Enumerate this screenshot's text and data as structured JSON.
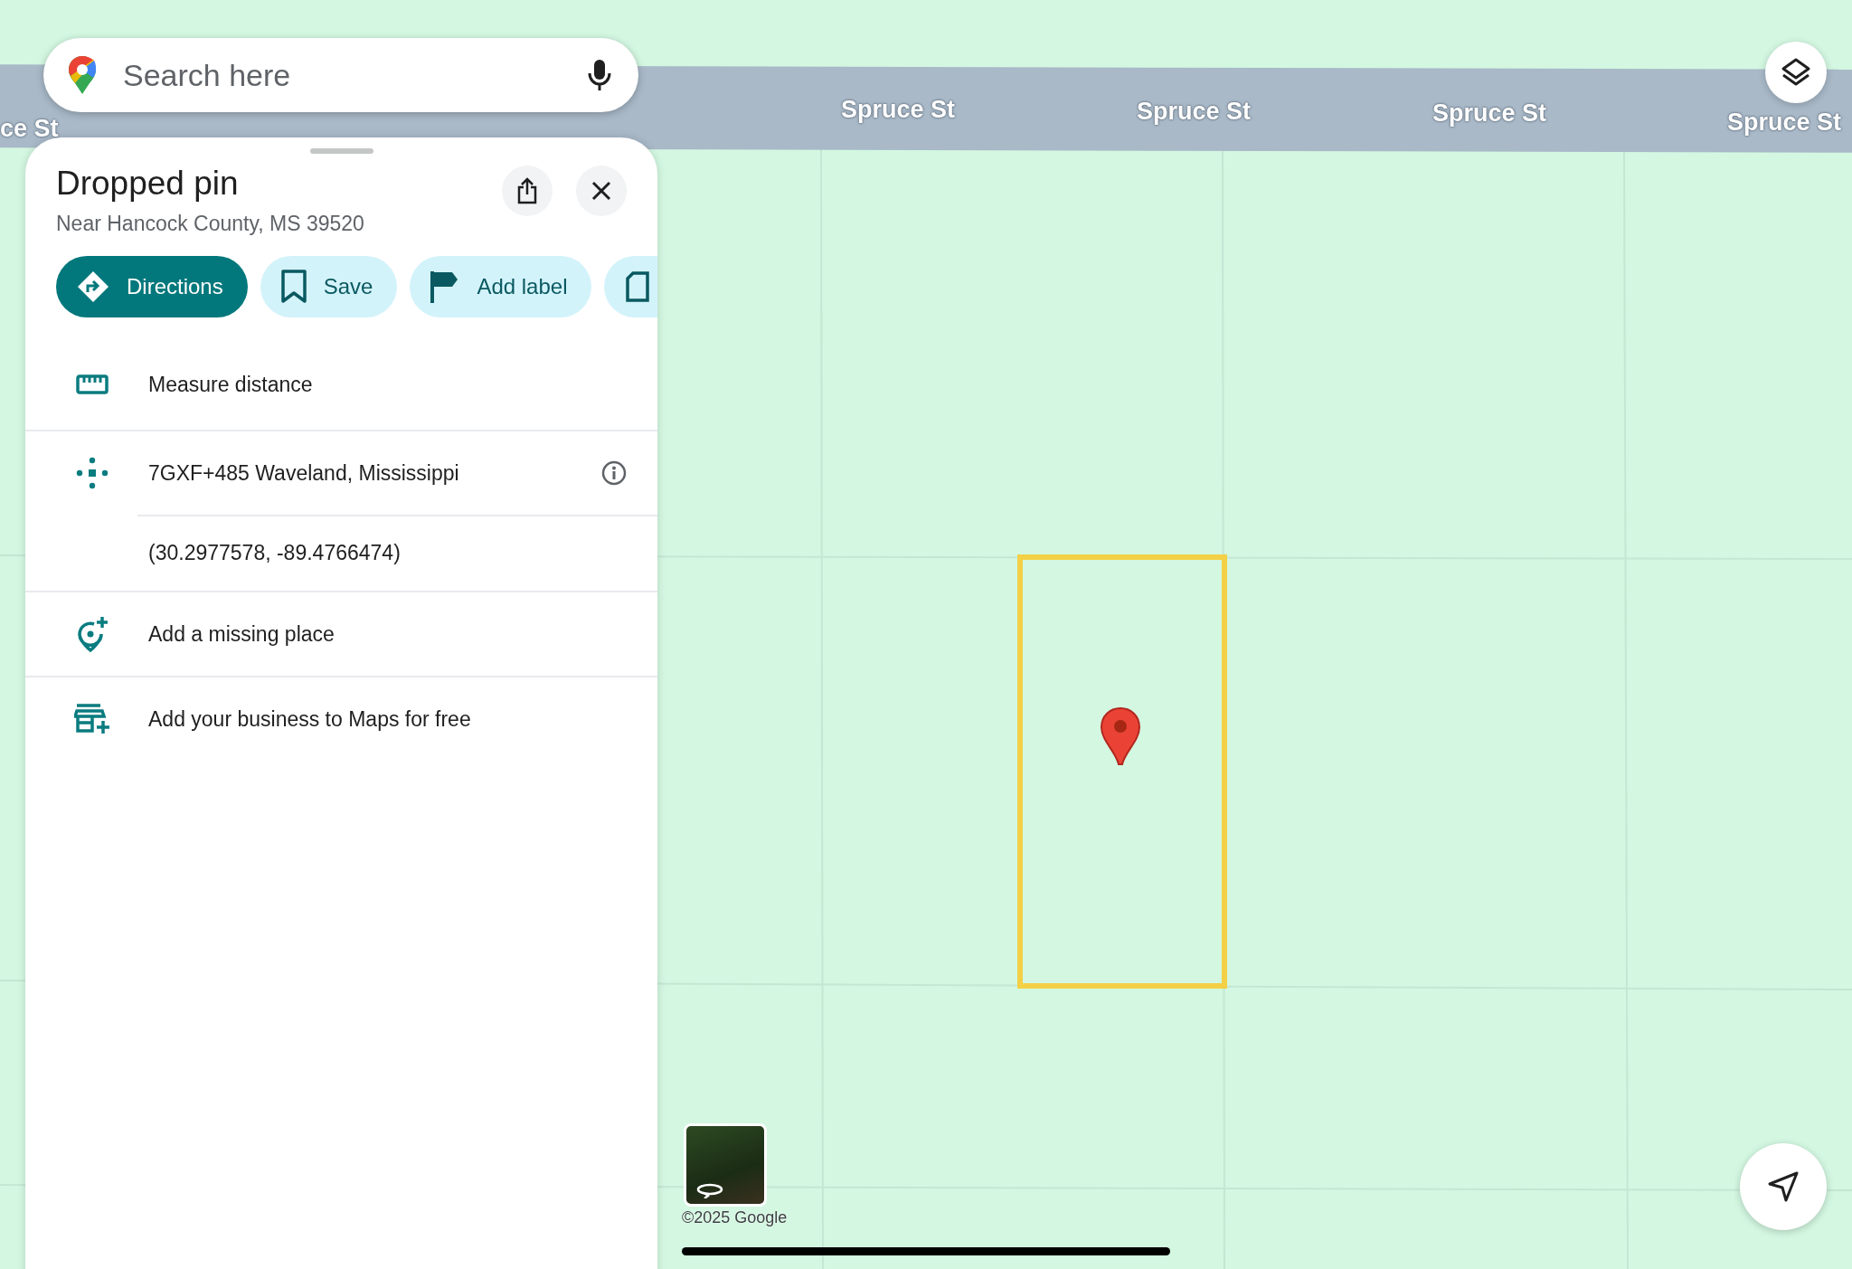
{
  "search": {
    "placeholder": "Search here"
  },
  "map": {
    "street_labels": [
      "ce St",
      "Spruce St",
      "Spruce St",
      "Spruce St",
      "Spruce St"
    ],
    "copyright": "©2025 Google"
  },
  "place": {
    "title": "Dropped pin",
    "subtitle": "Near Hancock County, MS 39520"
  },
  "actions": [
    {
      "kind": "directions",
      "label": "Directions",
      "primary": true
    },
    {
      "kind": "save",
      "label": "Save",
      "primary": false
    },
    {
      "kind": "flag",
      "label": "Add label",
      "primary": false
    },
    {
      "kind": "more",
      "primary": false
    }
  ],
  "details": [
    {
      "kind": "measure",
      "text": "Measure distance",
      "info": false
    },
    {
      "kind": "pluscode",
      "text": "7GXF+485 Waveland, Mississippi",
      "info": true
    },
    {
      "kind": "coords",
      "text": "(30.2977578, -89.4766474)",
      "info": false
    },
    {
      "kind": "addplace",
      "text": "Add a missing place",
      "info": false
    },
    {
      "kind": "business",
      "text": "Add your business to Maps for free",
      "info": false
    }
  ]
}
